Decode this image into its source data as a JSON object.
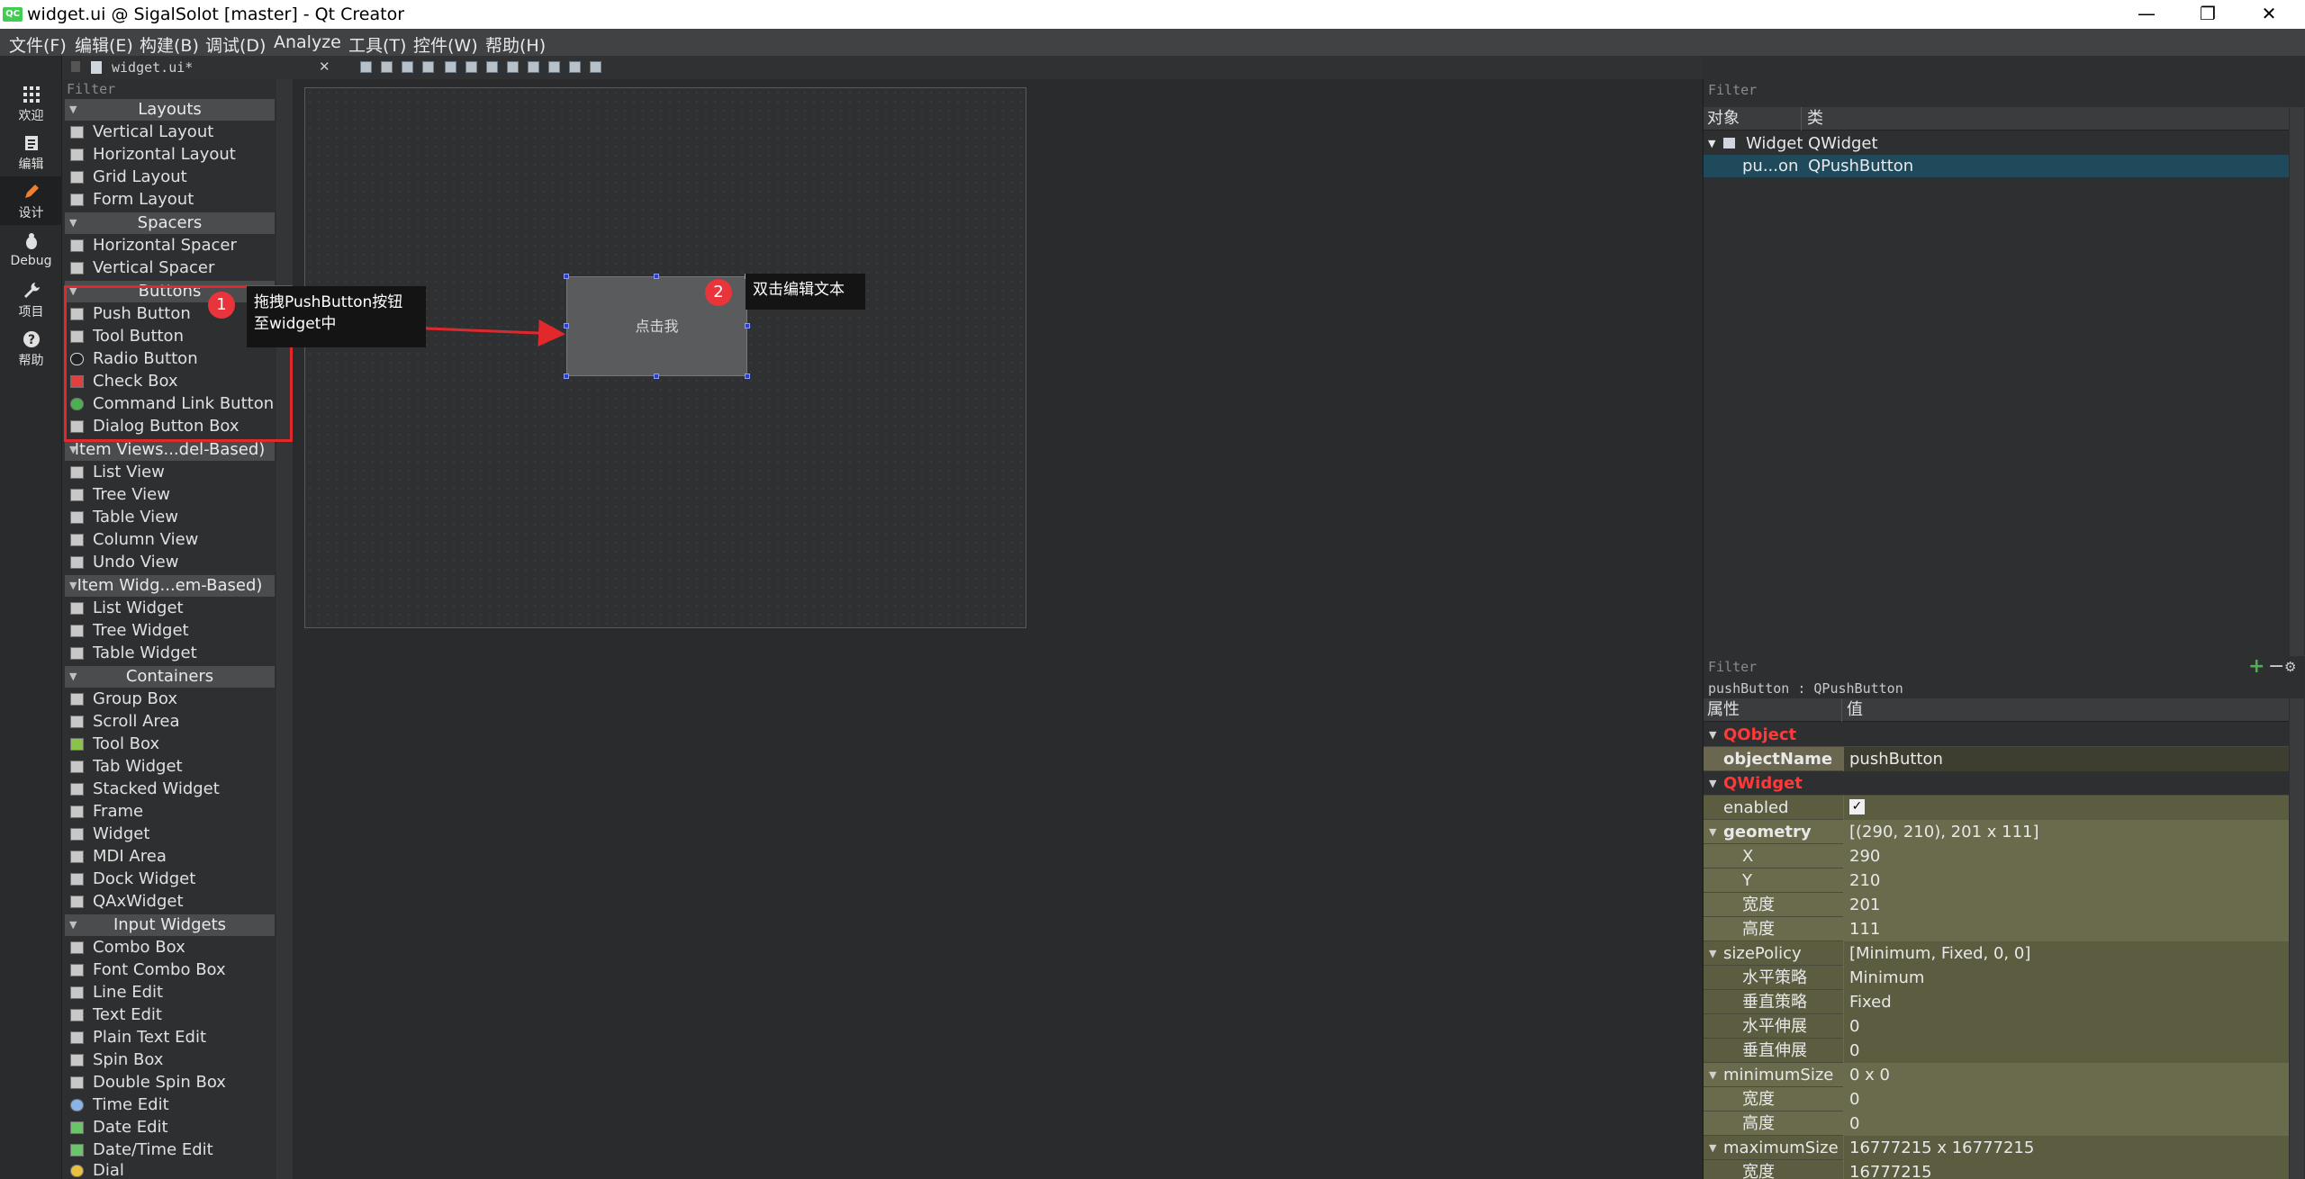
{
  "window": {
    "title": "widget.ui @ SigalSolot [master] - Qt Creator",
    "app_icon": "qt-creator-icon",
    "minimize": "—",
    "maximize": "❐",
    "close": "✕"
  },
  "menu": [
    "文件(F)",
    "编辑(E)",
    "构建(B)",
    "调试(D)",
    "Analyze",
    "工具(T)",
    "控件(W)",
    "帮助(H)"
  ],
  "modes": [
    {
      "label": "欢迎",
      "icon": "grid-icon"
    },
    {
      "label": "编辑",
      "icon": "document-icon"
    },
    {
      "label": "设计",
      "icon": "pencil-icon",
      "active": true
    },
    {
      "label": "Debug",
      "icon": "bug-icon"
    },
    {
      "label": "项目",
      "icon": "wrench-icon"
    },
    {
      "label": "帮助",
      "icon": "help-icon"
    }
  ],
  "editor": {
    "tab_title": "widget.ui*",
    "close": "✕"
  },
  "widget_box": {
    "filter_placeholder": "Filter",
    "categories": {
      "layouts": "Layouts",
      "spacers": "Spacers",
      "buttons": "Buttons",
      "item_views": "Item Views...del-Based)",
      "item_widgets": "Item Widg...em-Based)",
      "containers": "Containers",
      "input_widgets": "Input Widgets"
    },
    "items": {
      "layouts": [
        "Vertical Layout",
        "Horizontal Layout",
        "Grid Layout",
        "Form Layout"
      ],
      "spacers": [
        "Horizontal Spacer",
        "Vertical Spacer"
      ],
      "buttons": [
        "Push Button",
        "Tool Button",
        "Radio Button",
        "Check Box",
        "Command Link Button",
        "Dialog Button Box"
      ],
      "item_views": [
        "List View",
        "Tree View",
        "Table View",
        "Column View",
        "Undo View"
      ],
      "item_widgets": [
        "List Widget",
        "Tree Widget",
        "Table Widget"
      ],
      "containers": [
        "Group Box",
        "Scroll Area",
        "Tool Box",
        "Tab Widget",
        "Stacked Widget",
        "Frame",
        "Widget",
        "MDI Area",
        "Dock Widget",
        "QAxWidget"
      ],
      "input_widgets": [
        "Combo Box",
        "Font Combo Box",
        "Line Edit",
        "Text Edit",
        "Plain Text Edit",
        "Spin Box",
        "Double Spin Box",
        "Time Edit",
        "Date Edit",
        "Date/Time Edit",
        "Dial"
      ]
    }
  },
  "canvas": {
    "push_button_text": "点击我"
  },
  "annotations": {
    "badge1": "1",
    "tip1_line1": "拖拽PushButton按钮",
    "tip1_line2": "至widget中",
    "badge2": "2",
    "tip2": "双击编辑文本"
  },
  "object_inspector": {
    "filter_placeholder": "Filter",
    "col_object": "对象",
    "col_class": "类",
    "rows": [
      {
        "name": "Widget",
        "class": "QWidget"
      },
      {
        "name": "pu...on",
        "class": "QPushButton"
      }
    ]
  },
  "property_editor": {
    "filter_placeholder": "Filter",
    "context": "pushButton : QPushButton",
    "col_property": "属性",
    "col_value": "值",
    "qobject": "QObject",
    "objectName": {
      "name": "objectName",
      "value": "pushButton"
    },
    "qwidget": "QWidget",
    "enabled": {
      "name": "enabled",
      "value": "✓"
    },
    "geometry": {
      "name": "geometry",
      "value": "[(290, 210), 201 x 111]"
    },
    "x": {
      "name": "X",
      "value": "290"
    },
    "y": {
      "name": "Y",
      "value": "210"
    },
    "width": {
      "name": "宽度",
      "value": "201"
    },
    "height": {
      "name": "高度",
      "value": "111"
    },
    "sizePolicy": {
      "name": "sizePolicy",
      "value": "[Minimum, Fixed, 0, 0]"
    },
    "hpolicy": {
      "name": "水平策略",
      "value": "Minimum"
    },
    "vpolicy": {
      "name": "垂直策略",
      "value": "Fixed"
    },
    "hstretch": {
      "name": "水平伸展",
      "value": "0"
    },
    "vstretch": {
      "name": "垂直伸展",
      "value": "0"
    },
    "minimumSize": {
      "name": "minimumSize",
      "value": "0 x 0"
    },
    "min_w": {
      "name": "宽度",
      "value": "0"
    },
    "min_h": {
      "name": "高度",
      "value": "0"
    },
    "maximumSize": {
      "name": "maximumSize",
      "value": "16777215 x 16777215"
    },
    "max_w": {
      "name": "宽度",
      "value": "16777215"
    }
  }
}
